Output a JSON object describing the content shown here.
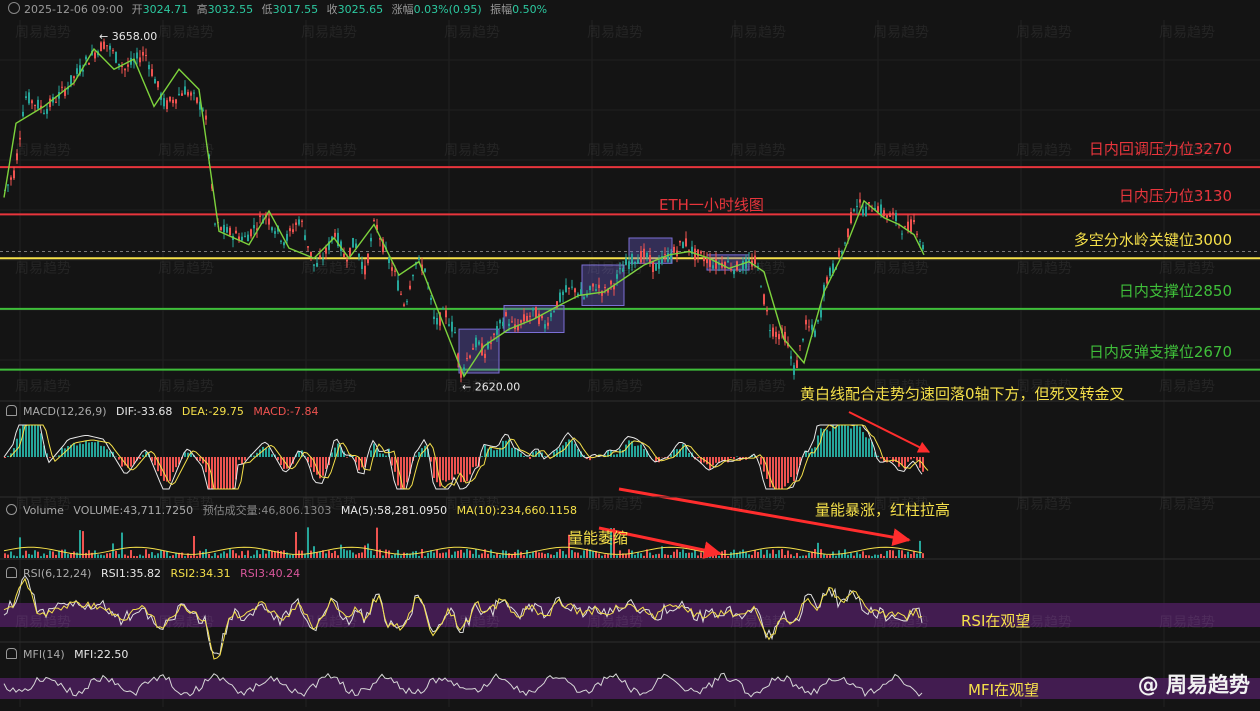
{
  "header": {
    "datetime": "2025-12-06 09:00",
    "open_label": "开",
    "open": "3024.71",
    "high_label": "高",
    "high": "3032.55",
    "low_label": "低",
    "low": "3017.55",
    "close_label": "收",
    "close": "3025.65",
    "change_label": "涨幅",
    "change": "0.03%(0.95)",
    "amp_label": "振幅",
    "amp": "0.50%"
  },
  "chart_data": {
    "type": "line",
    "title": "ETH一小时线图",
    "ylim": [
      2580,
      3700
    ],
    "price_x": [
      0,
      10,
      20,
      40,
      60,
      80,
      100,
      120,
      140,
      160,
      180,
      200,
      210,
      220,
      240,
      260,
      280,
      295,
      310,
      320,
      330,
      340,
      350,
      360,
      370,
      380,
      390,
      400,
      410,
      420,
      430,
      440,
      450,
      455,
      460,
      470,
      480,
      490,
      500,
      510,
      520,
      530,
      540,
      550,
      560,
      570,
      580,
      590,
      600,
      610,
      620,
      630,
      640,
      650,
      660,
      670,
      680,
      690,
      700,
      710,
      720,
      730,
      740,
      750,
      755,
      760,
      765,
      770,
      780,
      790,
      800,
      810,
      815,
      820,
      830,
      840,
      850,
      860,
      870,
      880,
      890,
      900,
      910,
      915,
      920
    ],
    "price": [
      3200,
      3260,
      3480,
      3440,
      3500,
      3580,
      3640,
      3560,
      3610,
      3450,
      3500,
      3440,
      3100,
      3080,
      3060,
      3130,
      3050,
      3120,
      2970,
      3010,
      3080,
      3000,
      3050,
      2960,
      3110,
      3020,
      2950,
      2860,
      2990,
      2970,
      2800,
      2840,
      2780,
      2660,
      2690,
      2750,
      2720,
      2770,
      2830,
      2790,
      2820,
      2840,
      2800,
      2860,
      2900,
      2910,
      2880,
      2920,
      2900,
      2930,
      2980,
      3000,
      3010,
      2970,
      3000,
      3020,
      3050,
      3010,
      3000,
      2980,
      2990,
      2970,
      2980,
      2990,
      2950,
      2860,
      2800,
      2780,
      2770,
      2660,
      2800,
      2780,
      2820,
      2930,
      2980,
      3040,
      3170,
      3140,
      3160,
      3130,
      3120,
      3080,
      3110,
      3060,
      3010
    ],
    "ma_x": [
      0,
      12,
      40,
      70,
      90,
      110,
      130,
      150,
      175,
      195,
      215,
      245,
      265,
      285,
      310,
      330,
      345,
      370,
      395,
      415,
      440,
      460,
      480,
      505,
      530,
      555,
      575,
      600,
      620,
      640,
      665,
      685,
      705,
      725,
      745,
      760,
      780,
      800,
      820,
      840,
      860,
      880,
      895,
      910,
      920
    ],
    "ma": [
      3180,
      3400,
      3450,
      3520,
      3620,
      3560,
      3590,
      3450,
      3560,
      3500,
      3080,
      3040,
      3140,
      3030,
      3000,
      3060,
      3000,
      3100,
      2950,
      2990,
      2800,
      2650,
      2740,
      2790,
      2820,
      2860,
      2890,
      2900,
      2940,
      2980,
      3010,
      3020,
      3000,
      2970,
      2990,
      2960,
      2760,
      2690,
      2900,
      3020,
      3170,
      3120,
      3100,
      3070,
      3010
    ],
    "levels": [
      {
        "value": 3270,
        "label": "日内回调压力位3270",
        "color": "#e8353c"
      },
      {
        "value": 3130,
        "label": "日内压力位3130",
        "color": "#e8353c"
      },
      {
        "value": 3000,
        "label": "多空分水岭关键位3000",
        "color": "#f5e04a"
      },
      {
        "value": 2850,
        "label": "日内支撑位2850",
        "color": "#3fbf3a"
      },
      {
        "value": 2670,
        "label": "日内反弹支撑位2670",
        "color": "#3fbf3a"
      }
    ],
    "high_mark": {
      "x": 95,
      "value": 3658,
      "label": "← 3658.00"
    },
    "low_mark": {
      "x": 458,
      "value": 2620,
      "label": "← 2620.00"
    },
    "boxes": [
      {
        "x0": 455,
        "x1": 495,
        "y0": 2660,
        "y1": 2790
      },
      {
        "x0": 500,
        "x1": 560,
        "y0": 2780,
        "y1": 2860
      },
      {
        "x0": 578,
        "x1": 620,
        "y0": 2860,
        "y1": 2980
      },
      {
        "x0": 625,
        "x1": 668,
        "y0": 2985,
        "y1": 3060
      },
      {
        "x0": 703,
        "x1": 745,
        "y0": 2965,
        "y1": 3010
      }
    ],
    "volume_arrows": [
      {
        "x0": 595,
        "v0": 1.0,
        "x1": 716,
        "v1": 0.15
      },
      {
        "x0": 615,
        "v0": 2.3,
        "x1": 905,
        "v1": 0.6
      }
    ],
    "macd_arrow": {
      "x0": 845,
      "x1": 925
    }
  },
  "price_labels": {
    "title": "ETH一小时线图"
  },
  "macd": {
    "name": "MACD(12,26,9)",
    "dif": "DIF:-33.68",
    "dea": "DEA:-29.75",
    "macd": "MACD:-7.84",
    "note": "黄白线配合走势匀速回落0轴下方，但死叉转金叉"
  },
  "volume": {
    "name": "Volume",
    "volume": "VOLUME:43,711.7250",
    "est": "预估成交量:46,806.1303",
    "ma5": "MA(5):58,281.0950",
    "ma10": "MA(10):234,660.1158",
    "note_shrink": "量能萎缩",
    "note_surge": "量能暴涨，红柱拉高"
  },
  "rsi": {
    "name": "RSI(6,12,24)",
    "rsi1": "RSI1:35.82",
    "rsi2": "RSI2:34.31",
    "rsi3": "RSI3:40.24",
    "note": "RSI在观望"
  },
  "mfi": {
    "name": "MFI(14)",
    "value": "MFI:22.50",
    "note": "MFI在观望"
  },
  "watermark": "周易趋势",
  "brand": "@ 周易趋势",
  "colors": {
    "up": "#26a69a",
    "down": "#ef5350",
    "ma": "#7dd23c",
    "dif": "#e8e8e8",
    "dea": "#f5e04a",
    "band": "#4a1d5a",
    "box": "#7b6fd6",
    "arrow": "#ff2d2d"
  }
}
